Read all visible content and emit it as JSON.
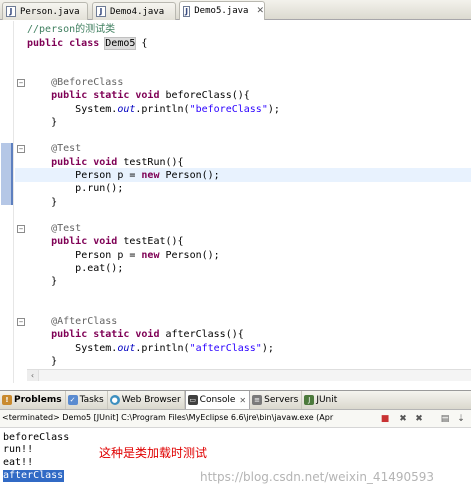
{
  "editor_tabs": [
    {
      "label": "Person.java"
    },
    {
      "label": "Demo4.java"
    },
    {
      "label": "Demo5.java",
      "close": "✕"
    }
  ],
  "code": {
    "l1": "//person的测试类",
    "l2_kw": "public class",
    "l2_name": "Demo5",
    "l2_rest": " {",
    "l3": "@BeforeClass",
    "l4_kw": "public static void",
    "l4_rest": " beforeClass(){",
    "l5_a": "System.",
    "l5_out": "out",
    "l5_b": ".println(",
    "l5_str": "\"beforeClass\"",
    "l5_c": ");",
    "l6": "}",
    "l7": "@Test",
    "l8_kw": "public void",
    "l8_rest": " testRun(){",
    "l9_a": "Person p = ",
    "l9_kw": "new",
    "l9_b": " Person();",
    "l10": "p.run();",
    "l11": "}",
    "l12": "@Test",
    "l13_kw": "public void",
    "l13_rest": " testEat(){",
    "l14_a": "Person p = ",
    "l14_kw": "new",
    "l14_b": " Person();",
    "l15": "p.eat();",
    "l16": "}",
    "l17": "@AfterClass",
    "l18_kw": "public static void",
    "l18_rest": " afterClass(){",
    "l19_a": "System.",
    "l19_out": "out",
    "l19_b": ".println(",
    "l19_str": "\"afterClass\"",
    "l19_c": ");",
    "l20": "}"
  },
  "views": {
    "problems": "Problems",
    "tasks": "Tasks",
    "web_browser": "Web Browser",
    "console": "Console",
    "console_close": "✕",
    "servers": "Servers",
    "junit": "JUnit"
  },
  "console": {
    "header": "<terminated> Demo5 [JUnit] C:\\Program Files\\MyEclipse 6.6\\jre\\bin\\javaw.exe (Apr",
    "lines": [
      "beforeClass",
      "run!!",
      "eat!!",
      "afterClass"
    ],
    "note": "这种是类加载时测试",
    "watermark": "https://blog.csdn.net/weixin_41490593"
  },
  "colors": {
    "keyword": "#7f0055",
    "comment": "#3f7f5f",
    "string": "#2a00ff",
    "selection": "#316ac5",
    "note": "#e00000"
  },
  "icons": {
    "java_file": "java-file-icon",
    "problems": "problems-icon",
    "tasks": "tasks-icon",
    "web_browser": "globe-icon",
    "console": "console-icon",
    "servers": "servers-icon",
    "junit": "junit-icon"
  }
}
